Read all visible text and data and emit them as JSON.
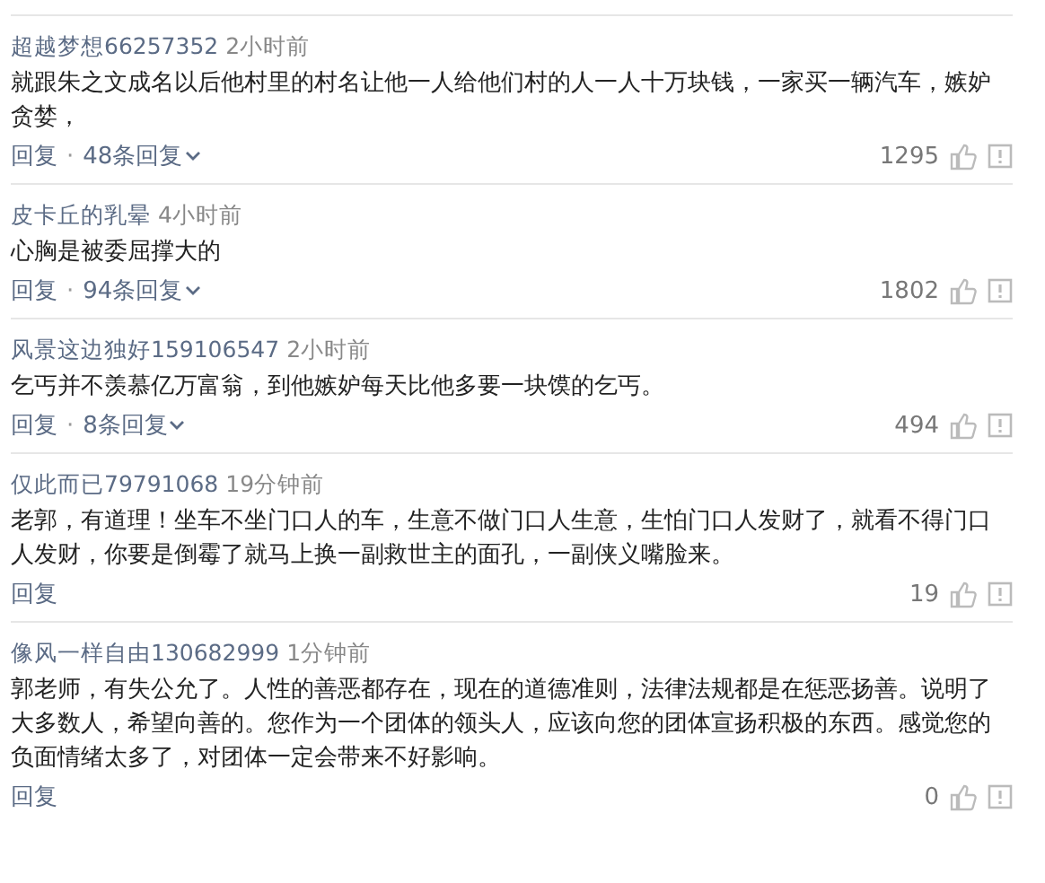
{
  "separator": "·",
  "comments": [
    {
      "user": "超越梦想66257352",
      "time": "2小时前",
      "text": "就跟朱之文成名以后他村里的村名让他一人给他们村的人一人十万块钱，一家买一辆汽车，嫉妒贪婪，",
      "reply": "回复",
      "replies": "48条回复",
      "likes": "1295"
    },
    {
      "user": "皮卡丘的乳晕",
      "time": "4小时前",
      "text": "心胸是被委屈撑大的",
      "reply": "回复",
      "replies": "94条回复",
      "likes": "1802"
    },
    {
      "user": "风景这边独好159106547",
      "time": "2小时前",
      "text": "乞丐并不羡慕亿万富翁，到他嫉妒每天比他多要一块馍的乞丐。",
      "reply": "回复",
      "replies": "8条回复",
      "likes": "494"
    },
    {
      "user": "仅此而已79791068",
      "time": "19分钟前",
      "text": "老郭，有道理！坐车不坐门口人的车，生意不做门口人生意，生怕门口人发财了，就看不得门口人发财，你要是倒霉了就马上换一副救世主的面孔，一副侠义嘴脸来。",
      "reply": "回复",
      "likes": "19"
    },
    {
      "user": "像风一样自由130682999",
      "time": "1分钟前",
      "text": "郭老师，有失公允了。人性的善恶都存在，现在的道德准则，法律法规都是在惩恶扬善。说明了大多数人，希望向善的。您作为一个团体的领头人，应该向您的团体宣扬积极的东西。感觉您的负面情绪太多了，对团体一定会带来不好影响。",
      "reply": "回复",
      "likes": "0"
    }
  ]
}
